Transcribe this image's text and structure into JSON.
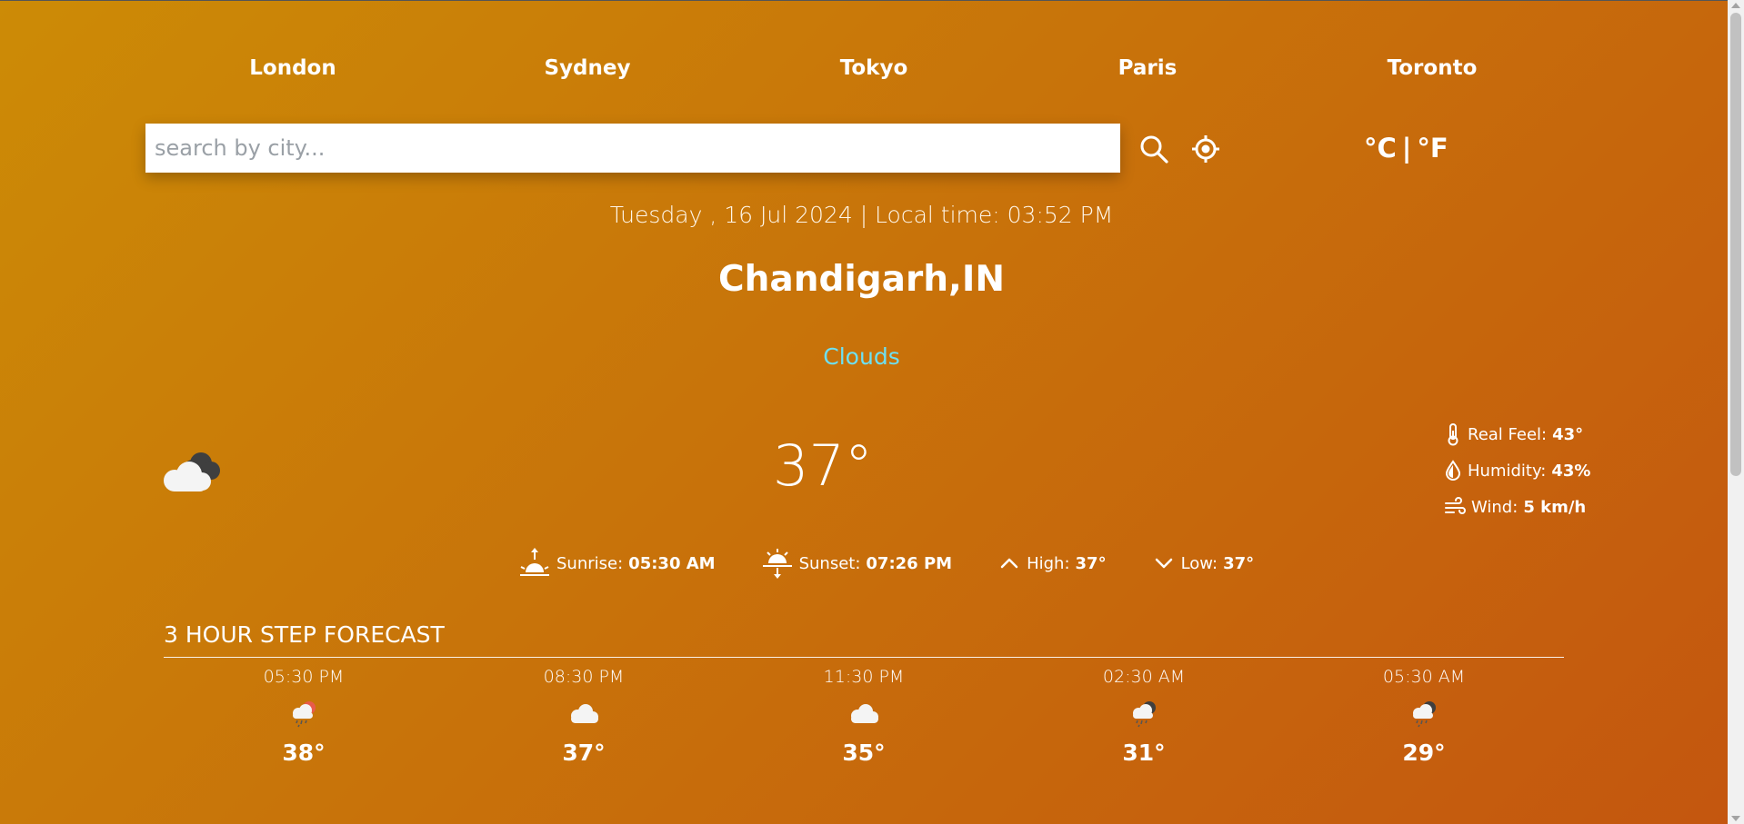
{
  "nav": {
    "cities": [
      "London",
      "Sydney",
      "Tokyo",
      "Paris",
      "Toronto"
    ]
  },
  "search": {
    "placeholder": "search by city...",
    "value": ""
  },
  "units": {
    "celsius": "°C",
    "separator": "|",
    "fahrenheit": "°F"
  },
  "current": {
    "datetime": "Tuesday , 16 Jul 2024 | Local time: 03:52 PM",
    "location": "Chandigarh,IN",
    "condition": "Clouds",
    "temperature": "37°",
    "icon": "cloud-icon",
    "details": {
      "real_feel_label": "Real Feel:",
      "real_feel_value": "43°",
      "humidity_label": "Humidity:",
      "humidity_value": "43%",
      "wind_label": "Wind:",
      "wind_value": "5 km/h"
    },
    "sun": {
      "sunrise_label": "Sunrise:",
      "sunrise_value": "05:30 AM",
      "sunset_label": "Sunset:",
      "sunset_value": "07:26 PM",
      "high_label": "High:",
      "high_value": "37°",
      "low_label": "Low:",
      "low_value": "37°"
    }
  },
  "forecast": {
    "title": "3 HOUR STEP FORECAST",
    "items": [
      {
        "time": "05:30 PM",
        "icon": "rain-sun-icon",
        "temp": "38°"
      },
      {
        "time": "08:30 PM",
        "icon": "cloud-icon",
        "temp": "37°"
      },
      {
        "time": "11:30 PM",
        "icon": "cloud-icon",
        "temp": "35°"
      },
      {
        "time": "02:30 AM",
        "icon": "rain-cloud-icon",
        "temp": "31°"
      },
      {
        "time": "05:30 AM",
        "icon": "rain-cloud-icon",
        "temp": "29°"
      }
    ]
  },
  "colors": {
    "background_start": "#cc8b06",
    "background_end": "#c4560f",
    "condition": "#6ee0f2",
    "text": "#ffffff"
  }
}
